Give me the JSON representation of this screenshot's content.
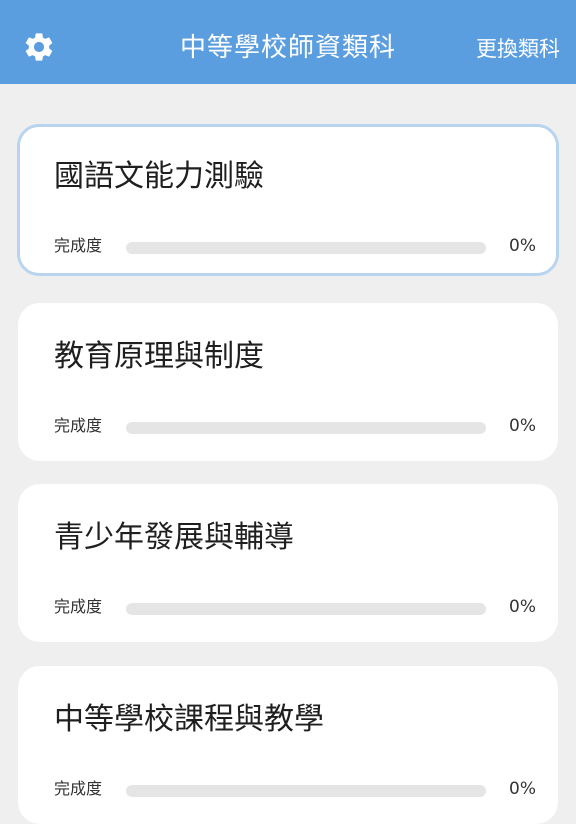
{
  "header": {
    "title": "中等學校師資類科",
    "switch_label": "更換類科",
    "settings_icon": "gear-icon",
    "background_color": "#5b9ee0"
  },
  "progress_label": "完成度",
  "subjects": [
    {
      "title": "國語文能力測驗",
      "progress_text": "0%",
      "progress": 0,
      "selected": true
    },
    {
      "title": "教育原理與制度",
      "progress_text": "0%",
      "progress": 0,
      "selected": false
    },
    {
      "title": "青少年發展與輔導",
      "progress_text": "0%",
      "progress": 0,
      "selected": false
    },
    {
      "title": "中等學校課程與教學",
      "progress_text": "0%",
      "progress": 0,
      "selected": false
    }
  ]
}
